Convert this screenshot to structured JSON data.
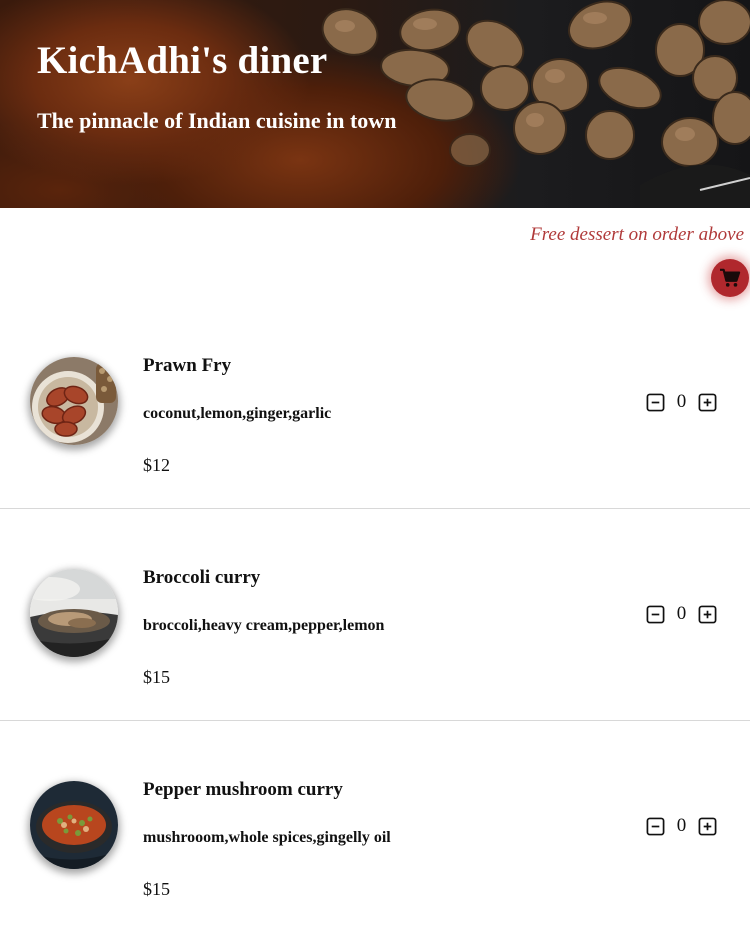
{
  "header": {
    "title": "KichAdhi's diner",
    "subtitle": "The pinnacle of Indian cuisine in town"
  },
  "promo": {
    "text": "Free dessert on order above"
  },
  "cart": {
    "icon": "cart-icon",
    "color": "#b0282d"
  },
  "menu": {
    "items": [
      {
        "name": "Prawn Fry",
        "ingredients": "coconut,lemon,ginger,garlic",
        "price": "$12",
        "quantity": "0",
        "image": "prawn-fry-photo"
      },
      {
        "name": "Broccoli curry",
        "ingredients": "broccoli,heavy cream,pepper,lemon",
        "price": "$15",
        "quantity": "0",
        "image": "broccoli-curry-photo"
      },
      {
        "name": "Pepper mushroom curry",
        "ingredients": "mushrooom,whole spices,gingelly oil",
        "price": "$15",
        "quantity": "0",
        "image": "pepper-mushroom-curry-photo"
      }
    ],
    "decrement_icon": "minus-square-icon",
    "increment_icon": "plus-square-icon"
  },
  "colors": {
    "accent": "#b0282d",
    "promo_text": "#b03a3a"
  }
}
